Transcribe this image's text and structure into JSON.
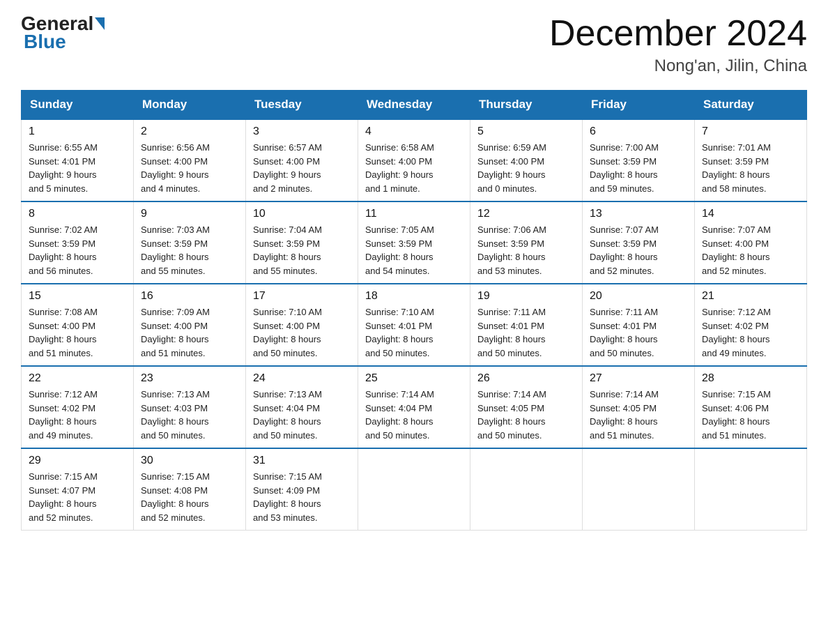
{
  "header": {
    "logo": {
      "general": "General",
      "blue": "Blue"
    },
    "title": "December 2024",
    "location": "Nong'an, Jilin, China"
  },
  "days_of_week": [
    "Sunday",
    "Monday",
    "Tuesday",
    "Wednesday",
    "Thursday",
    "Friday",
    "Saturday"
  ],
  "weeks": [
    [
      {
        "day": "1",
        "sunrise": "6:55 AM",
        "sunset": "4:01 PM",
        "daylight": "9 hours and 5 minutes."
      },
      {
        "day": "2",
        "sunrise": "6:56 AM",
        "sunset": "4:00 PM",
        "daylight": "9 hours and 4 minutes."
      },
      {
        "day": "3",
        "sunrise": "6:57 AM",
        "sunset": "4:00 PM",
        "daylight": "9 hours and 2 minutes."
      },
      {
        "day": "4",
        "sunrise": "6:58 AM",
        "sunset": "4:00 PM",
        "daylight": "9 hours and 1 minute."
      },
      {
        "day": "5",
        "sunrise": "6:59 AM",
        "sunset": "4:00 PM",
        "daylight": "9 hours and 0 minutes."
      },
      {
        "day": "6",
        "sunrise": "7:00 AM",
        "sunset": "3:59 PM",
        "daylight": "8 hours and 59 minutes."
      },
      {
        "day": "7",
        "sunrise": "7:01 AM",
        "sunset": "3:59 PM",
        "daylight": "8 hours and 58 minutes."
      }
    ],
    [
      {
        "day": "8",
        "sunrise": "7:02 AM",
        "sunset": "3:59 PM",
        "daylight": "8 hours and 56 minutes."
      },
      {
        "day": "9",
        "sunrise": "7:03 AM",
        "sunset": "3:59 PM",
        "daylight": "8 hours and 55 minutes."
      },
      {
        "day": "10",
        "sunrise": "7:04 AM",
        "sunset": "3:59 PM",
        "daylight": "8 hours and 55 minutes."
      },
      {
        "day": "11",
        "sunrise": "7:05 AM",
        "sunset": "3:59 PM",
        "daylight": "8 hours and 54 minutes."
      },
      {
        "day": "12",
        "sunrise": "7:06 AM",
        "sunset": "3:59 PM",
        "daylight": "8 hours and 53 minutes."
      },
      {
        "day": "13",
        "sunrise": "7:07 AM",
        "sunset": "3:59 PM",
        "daylight": "8 hours and 52 minutes."
      },
      {
        "day": "14",
        "sunrise": "7:07 AM",
        "sunset": "4:00 PM",
        "daylight": "8 hours and 52 minutes."
      }
    ],
    [
      {
        "day": "15",
        "sunrise": "7:08 AM",
        "sunset": "4:00 PM",
        "daylight": "8 hours and 51 minutes."
      },
      {
        "day": "16",
        "sunrise": "7:09 AM",
        "sunset": "4:00 PM",
        "daylight": "8 hours and 51 minutes."
      },
      {
        "day": "17",
        "sunrise": "7:10 AM",
        "sunset": "4:00 PM",
        "daylight": "8 hours and 50 minutes."
      },
      {
        "day": "18",
        "sunrise": "7:10 AM",
        "sunset": "4:01 PM",
        "daylight": "8 hours and 50 minutes."
      },
      {
        "day": "19",
        "sunrise": "7:11 AM",
        "sunset": "4:01 PM",
        "daylight": "8 hours and 50 minutes."
      },
      {
        "day": "20",
        "sunrise": "7:11 AM",
        "sunset": "4:01 PM",
        "daylight": "8 hours and 50 minutes."
      },
      {
        "day": "21",
        "sunrise": "7:12 AM",
        "sunset": "4:02 PM",
        "daylight": "8 hours and 49 minutes."
      }
    ],
    [
      {
        "day": "22",
        "sunrise": "7:12 AM",
        "sunset": "4:02 PM",
        "daylight": "8 hours and 49 minutes."
      },
      {
        "day": "23",
        "sunrise": "7:13 AM",
        "sunset": "4:03 PM",
        "daylight": "8 hours and 50 minutes."
      },
      {
        "day": "24",
        "sunrise": "7:13 AM",
        "sunset": "4:04 PM",
        "daylight": "8 hours and 50 minutes."
      },
      {
        "day": "25",
        "sunrise": "7:14 AM",
        "sunset": "4:04 PM",
        "daylight": "8 hours and 50 minutes."
      },
      {
        "day": "26",
        "sunrise": "7:14 AM",
        "sunset": "4:05 PM",
        "daylight": "8 hours and 50 minutes."
      },
      {
        "day": "27",
        "sunrise": "7:14 AM",
        "sunset": "4:05 PM",
        "daylight": "8 hours and 51 minutes."
      },
      {
        "day": "28",
        "sunrise": "7:15 AM",
        "sunset": "4:06 PM",
        "daylight": "8 hours and 51 minutes."
      }
    ],
    [
      {
        "day": "29",
        "sunrise": "7:15 AM",
        "sunset": "4:07 PM",
        "daylight": "8 hours and 52 minutes."
      },
      {
        "day": "30",
        "sunrise": "7:15 AM",
        "sunset": "4:08 PM",
        "daylight": "8 hours and 52 minutes."
      },
      {
        "day": "31",
        "sunrise": "7:15 AM",
        "sunset": "4:09 PM",
        "daylight": "8 hours and 53 minutes."
      },
      null,
      null,
      null,
      null
    ]
  ],
  "labels": {
    "sunrise": "Sunrise:",
    "sunset": "Sunset:",
    "daylight": "Daylight:"
  }
}
